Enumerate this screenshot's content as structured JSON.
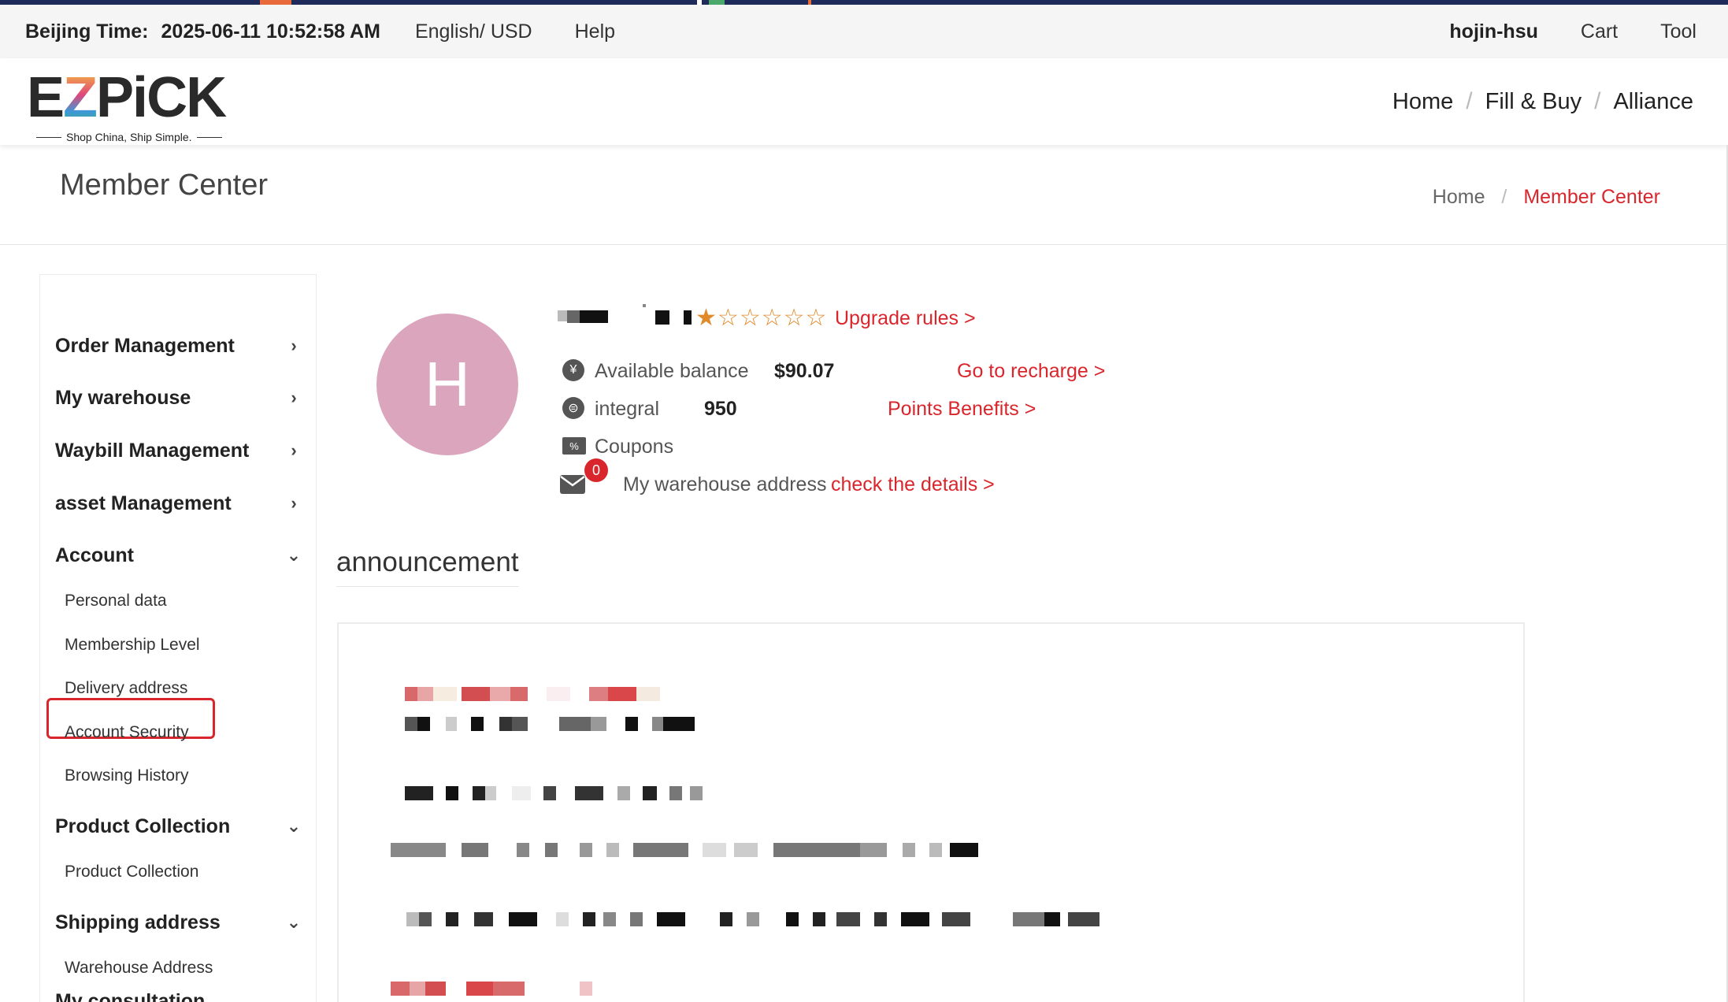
{
  "topbar": {
    "time_label": "Beijing Time:",
    "time_value": "2025-06-11 10:52:58 AM",
    "language_currency": "English/ USD",
    "help": "Help",
    "username": "hojin-hsu",
    "cart": "Cart",
    "tool": "Tool"
  },
  "logo": {
    "letters": [
      "E",
      "Z",
      "P",
      "i",
      "C",
      "K"
    ],
    "tagline": "Shop China, Ship Simple."
  },
  "main_nav": {
    "items": [
      "Home",
      "Fill & Buy",
      "Alliance"
    ],
    "separator": "/"
  },
  "page_header": {
    "title": "Member Center",
    "breadcrumb": [
      "Home",
      "Member Center"
    ],
    "breadcrumb_separator": "/"
  },
  "sidebar": {
    "groups": [
      {
        "label": "Order Management",
        "chevron": "chevron-right-icon"
      },
      {
        "label": "My warehouse",
        "chevron": "chevron-right-icon"
      },
      {
        "label": "Waybill Management",
        "chevron": "chevron-right-icon"
      },
      {
        "label": "asset Management",
        "chevron": "chevron-right-icon"
      },
      {
        "label": "Account",
        "chevron": "chevron-down-icon"
      },
      {
        "label": "Product Collection",
        "chevron": "chevron-down-icon"
      },
      {
        "label": "Shipping address",
        "chevron": "chevron-down-icon"
      },
      {
        "label": "My consultation",
        "chevron": "chevron-down-icon"
      }
    ],
    "account_items": [
      "Personal data",
      "Membership Level",
      "Delivery address",
      "Account Security",
      "Browsing History"
    ],
    "collection_items": [
      "Product Collection"
    ],
    "shipping_items": [
      "Warehouse Address"
    ],
    "highlighted_item": "Account Security",
    "highlight_color": "#d9262c"
  },
  "profile": {
    "avatar_letter": "H",
    "avatar_color": "#dba6bd",
    "star_rating": 1,
    "star_max": 6,
    "upgrade_link": "Upgrade rules >",
    "balance_label": "Available balance",
    "balance_value": "$90.07",
    "recharge_link": "Go to recharge >",
    "integral_label": "integral",
    "integral_value": "950",
    "points_link": "Points Benefits >",
    "coupons_label": "Coupons",
    "message_count": "0",
    "warehouse_label": "My warehouse address",
    "warehouse_link": "check the details >"
  },
  "announcement": {
    "title": "announcement"
  },
  "colors": {
    "accent": "#d9262c",
    "topbar_bg": "#f5f5f5",
    "star": "#e08a2a"
  }
}
